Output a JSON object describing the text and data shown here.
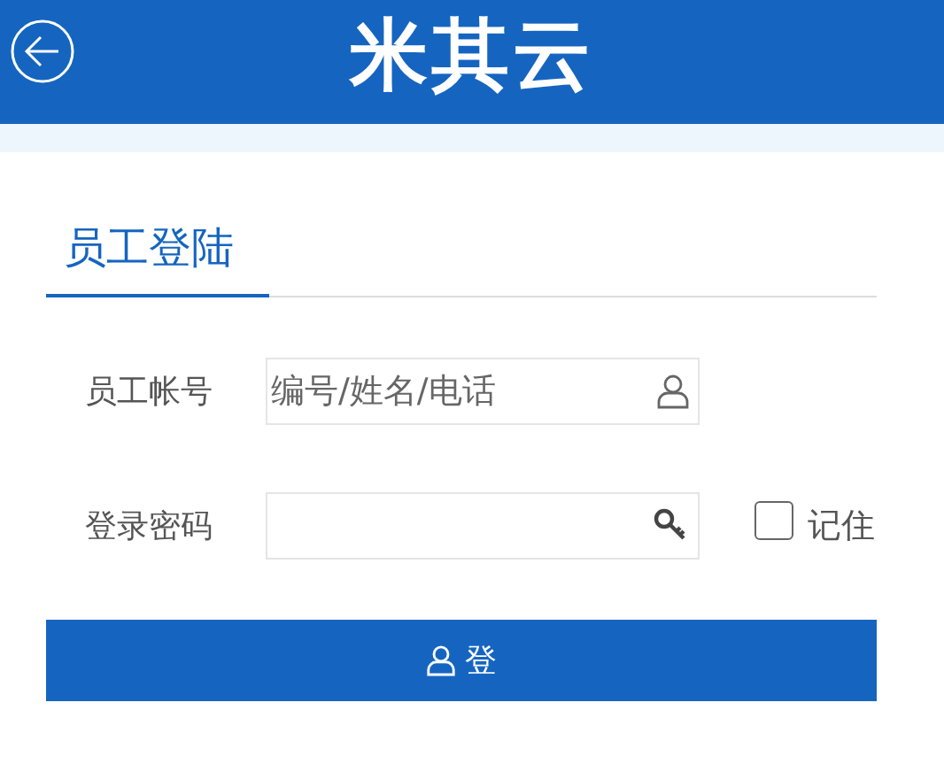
{
  "header": {
    "logo": "米其云"
  },
  "section_title": "员工登陆",
  "fields": [
    {
      "label": "员工帐号",
      "placeholder": "编号/姓名/电话",
      "kind": "user"
    },
    {
      "label": "登录密码",
      "kind": "key"
    }
  ],
  "remember": {
    "label": "记住",
    "checked": false
  },
  "login_button": {
    "label": "登"
  }
}
